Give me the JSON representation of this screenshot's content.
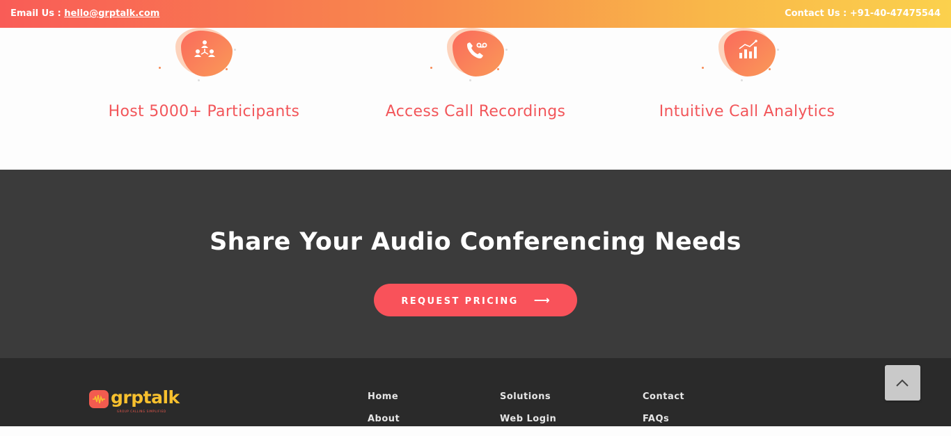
{
  "topbar": {
    "email_prefix": "Email Us : ",
    "email": "hello@grptalk.com",
    "contact": "Contact Us : +91-40-47475544"
  },
  "features": [
    {
      "title": "Host 5000+ Participants",
      "icon": "participants-icon"
    },
    {
      "title": "Access Call Recordings",
      "icon": "call-recording-icon"
    },
    {
      "title": "Intuitive Call Analytics",
      "icon": "analytics-icon"
    }
  ],
  "cta": {
    "heading": "Share Your Audio Conferencing Needs",
    "button_label": "REQUEST PRICING",
    "button_arrow": "⟶"
  },
  "footer": {
    "logo_text": "grptalk",
    "logo_tagline": "GROUP CALLING SIMPLIFIED",
    "columns": [
      [
        "Home",
        "About"
      ],
      [
        "Solutions",
        "Web Login"
      ],
      [
        "Contact",
        "FAQs"
      ]
    ]
  },
  "colors": {
    "accent": "#f9525a",
    "feature_title": "#f2565a",
    "cta_bg": "#3b3b3b",
    "footer_bg": "#2a2a2a",
    "logo_yellow": "#f7c02e"
  }
}
